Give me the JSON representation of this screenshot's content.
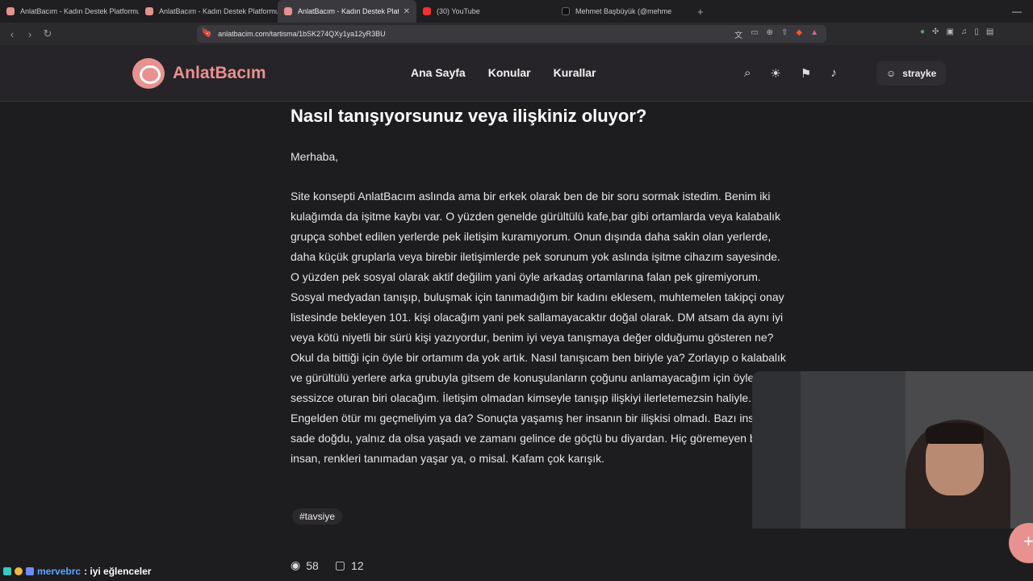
{
  "browser": {
    "tabs": [
      {
        "title": "AnlatBacım - Kadın Destek Platformu",
        "active": false
      },
      {
        "title": "AnlatBacım - Kadın Destek Platformu",
        "active": false
      },
      {
        "title": "AnlatBacım - Kadın Destek Platfo",
        "active": true
      },
      {
        "title": "(30) YouTube",
        "active": false
      },
      {
        "title": "Mehmet Başbüyük (@mehme",
        "active": false
      }
    ],
    "close_glyph": "✕",
    "new_tab_glyph": "+",
    "url": "anlatbacim.com/tartisma/1bSK274QXy1ya12yR3BU"
  },
  "site": {
    "logo_text": "AnlatBacım",
    "nav": [
      "Ana Sayfa",
      "Konular",
      "Kurallar"
    ],
    "username": "strayke",
    "brand_color": "#e8918f"
  },
  "post": {
    "title": "Nasıl tanışıyorsunuz veya ilişkiniz oluyor?",
    "greeting": "Merhaba,",
    "body": "Site konsepti AnlatBacım aslında ama bir erkek olarak ben de bir soru sormak istedim. Benim iki kulağımda da işitme kaybı var. O yüzden genelde gürültülü kafe,bar gibi ortamlarda veya kalabalık grupça sohbet edilen yerlerde pek iletişim kuramıyorum. Onun dışında daha sakin olan yerlerde, daha küçük gruplarla veya birebir iletişimlerde pek sorunum yok aslında işitme cihazım sayesinde. O yüzden pek sosyal olarak aktif değilim yani öyle arkadaş ortamlarına falan pek giremiyorum. Sosyal medyadan tanışıp,  buluşmak için tanımadığım bir kadını eklesem, muhtemelen takipçi onay listesinde bekleyen 101. kişi olacağım yani pek sallamayacaktır doğal olarak. DM atsam da aynı iyi veya kötü niyetli bir sürü kişi yazıyordur, benim iyi veya tanışmaya değer olduğumu gösteren ne? Okul da bittiği için öyle bir ortamım da yok artık. Nasıl tanışıcam ben biriyle ya? Zorlayıp o kalabalık ve gürültülü yerlere arka grubuyla gitsem de konuşulanların çoğunu anlamayacağım için öyle sessizce oturan biri olacağım. İletişim olmadan kimseyle tanışıp ilişkiyi ilerletemezsin haliyle. Engelden ötür mı geçmeliyim ya da? Sonuçta yaşamış her insanın bir ilişkisi olmadı. Bazı insanlar sade doğdu, yalnız da olsa yaşadı ve zamanı gelince de göçtü bu diyardan. Hiç göremeyen bi insan, renkleri tanımadan yaşar ya, o misal. Kafam çok karışık.",
    "tag": "#tavsiye",
    "views": "58",
    "comments": "12"
  },
  "overlay": {
    "chat_user": "mervebrc",
    "chat_message": ": iyi eğlenceler",
    "fab_glyph": "+"
  }
}
